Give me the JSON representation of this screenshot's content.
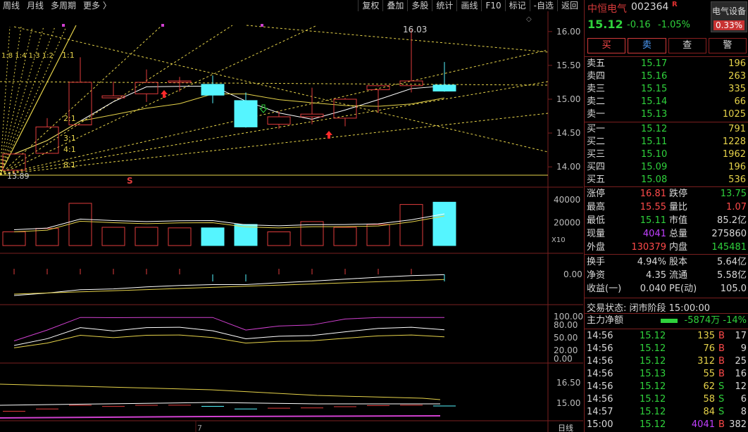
{
  "toolbar": {
    "left": [
      "周线",
      "月线",
      "多周期",
      "更多 〉"
    ],
    "right": [
      "复权",
      "叠加",
      "多股",
      "统计",
      "画线",
      "F10",
      "标记",
      "-自选",
      "返回"
    ]
  },
  "chart": {
    "price_labels": [
      "16.00",
      "15.50",
      "15.00",
      "14.50",
      "14.00"
    ],
    "volume_labels": [
      "40000",
      "20000"
    ],
    "volume_unit": "X10",
    "macd_label": "0.00",
    "kdj_labels": [
      "100.00",
      "80.00",
      "50.00",
      "20.00",
      "0.00"
    ],
    "bottom_labels": [
      "16.50",
      "15.00"
    ],
    "annotations": {
      "high": "16.03",
      "low": "13.89",
      "ratios": [
        "1:1",
        "2:1",
        "3:1",
        "4:1",
        "8:1",
        "1:8 1:4 1:3 1:2"
      ],
      "marker_s": "S",
      "marker_b": "B",
      "bottom_date": "7",
      "diamond": "◇",
      "daily": "日线"
    },
    "colors": {
      "up": "#e03c3c",
      "down": "#55f5ff",
      "ma": "#ffffff",
      "gann": "#e6d34a",
      "kdj_k": "#ffffff",
      "kdj_d": "#e6d34a",
      "kdj_j": "#d040d0"
    }
  },
  "chart_data": {
    "type": "candlestick",
    "candles": [
      {
        "o": 13.95,
        "h": 14.2,
        "l": 13.89,
        "c": 14.19,
        "vol": 12000
      },
      {
        "o": 14.2,
        "h": 14.72,
        "l": 14.2,
        "c": 14.59,
        "vol": 15000
      },
      {
        "o": 14.62,
        "h": 15.62,
        "l": 14.62,
        "c": 15.25,
        "vol": 37000
      },
      {
        "o": 15.02,
        "h": 15.26,
        "l": 15.02,
        "c": 15.05,
        "vol": 16000
      },
      {
        "o": 15.08,
        "h": 15.44,
        "l": 14.96,
        "c": 15.25,
        "vol": 16000
      },
      {
        "o": 15.27,
        "h": 15.33,
        "l": 15.11,
        "c": 15.27,
        "vol": 15500
      },
      {
        "o": 15.22,
        "h": 15.35,
        "l": 14.94,
        "c": 15.06,
        "vol": 15500
      },
      {
        "o": 14.98,
        "h": 15.1,
        "l": 14.58,
        "c": 14.59,
        "vol": 18500
      },
      {
        "o": 14.63,
        "h": 14.82,
        "l": 14.56,
        "c": 14.74,
        "vol": 12000
      },
      {
        "o": 14.74,
        "h": 15.17,
        "l": 14.63,
        "c": 14.78,
        "vol": 21000
      },
      {
        "o": 14.72,
        "h": 15.02,
        "l": 14.6,
        "c": 15.0,
        "vol": 16000
      },
      {
        "o": 15.14,
        "h": 15.19,
        "l": 14.8,
        "c": 15.2,
        "vol": 18500
      },
      {
        "o": 15.2,
        "h": 16.03,
        "l": 15.1,
        "c": 15.27,
        "vol": 36000
      },
      {
        "o": 15.21,
        "h": 15.55,
        "l": 15.11,
        "c": 15.12,
        "vol": 38000
      }
    ]
  },
  "panel": {
    "name": "中恒电气",
    "code": "002364",
    "rmark": "R",
    "sector": "电气设备",
    "sector_pct": "0.33%",
    "price": "15.12",
    "change": "-0.16",
    "change_pct": "-1.05%",
    "buttons": [
      "买",
      "卖",
      "查",
      "警"
    ],
    "asks": [
      {
        "label": "卖五",
        "price": "15.17",
        "vol": "196"
      },
      {
        "label": "卖四",
        "price": "15.16",
        "vol": "263"
      },
      {
        "label": "卖三",
        "price": "15.15",
        "vol": "335"
      },
      {
        "label": "卖二",
        "price": "15.14",
        "vol": "66"
      },
      {
        "label": "卖一",
        "price": "15.13",
        "vol": "1025"
      }
    ],
    "bids": [
      {
        "label": "买一",
        "price": "15.12",
        "vol": "791"
      },
      {
        "label": "买二",
        "price": "15.11",
        "vol": "1228"
      },
      {
        "label": "买三",
        "price": "15.10",
        "vol": "1962"
      },
      {
        "label": "买四",
        "price": "15.09",
        "vol": "196"
      },
      {
        "label": "买五",
        "price": "15.08",
        "vol": "536"
      }
    ],
    "stats1": [
      {
        "k1": "涨停",
        "v1": "16.81",
        "c1": "red",
        "k2": "跌停",
        "v2": "13.75",
        "c2": "grn"
      },
      {
        "k1": "最高",
        "v1": "15.55",
        "c1": "red",
        "k2": "量比",
        "v2": "1.07",
        "c2": "red"
      },
      {
        "k1": "最低",
        "v1": "15.11",
        "c1": "grn",
        "k2": "市值",
        "v2": "85.2亿",
        "c2": "wht"
      },
      {
        "k1": "现量",
        "v1": "4041",
        "c1": "pur",
        "k2": "总量",
        "v2": "275860",
        "c2": "wht"
      },
      {
        "k1": "外盘",
        "v1": "130379",
        "c1": "red",
        "k2": "内盘",
        "v2": "145481",
        "c2": "grn"
      }
    ],
    "stats2": [
      {
        "k1": "换手",
        "v1": "4.94%",
        "c1": "wht",
        "k2": "股本",
        "v2": "5.64亿",
        "c2": "wht"
      },
      {
        "k1": "净资",
        "v1": "4.35",
        "c1": "wht",
        "k2": "流通",
        "v2": "5.58亿",
        "c2": "wht"
      },
      {
        "k1": "收益(一)",
        "v1": "0.040",
        "c1": "wht",
        "k2": "PE(动)",
        "v2": "105.0",
        "c2": "wht"
      }
    ],
    "trade_status": "交易状态: 闭市阶段 15:00:00",
    "flow_label": "主力净额",
    "flow_value": "-5874万 -14%",
    "ticks": [
      {
        "t": "14:56",
        "p": "15.12",
        "v": "135",
        "d": "B",
        "n": "17"
      },
      {
        "t": "14:56",
        "p": "15.12",
        "v": "76",
        "d": "B",
        "n": "9"
      },
      {
        "t": "14:56",
        "p": "15.12",
        "v": "312",
        "d": "B",
        "n": "25"
      },
      {
        "t": "14:56",
        "p": "15.13",
        "v": "55",
        "d": "B",
        "n": "16"
      },
      {
        "t": "14:56",
        "p": "15.12",
        "v": "62",
        "d": "S",
        "n": "12"
      },
      {
        "t": "14:56",
        "p": "15.12",
        "v": "58",
        "d": "S",
        "n": "6"
      },
      {
        "t": "14:57",
        "p": "15.12",
        "v": "84",
        "d": "S",
        "n": "8"
      },
      {
        "t": "15:00",
        "p": "15.12",
        "v": "4041",
        "d": "B",
        "n": "382"
      }
    ]
  }
}
